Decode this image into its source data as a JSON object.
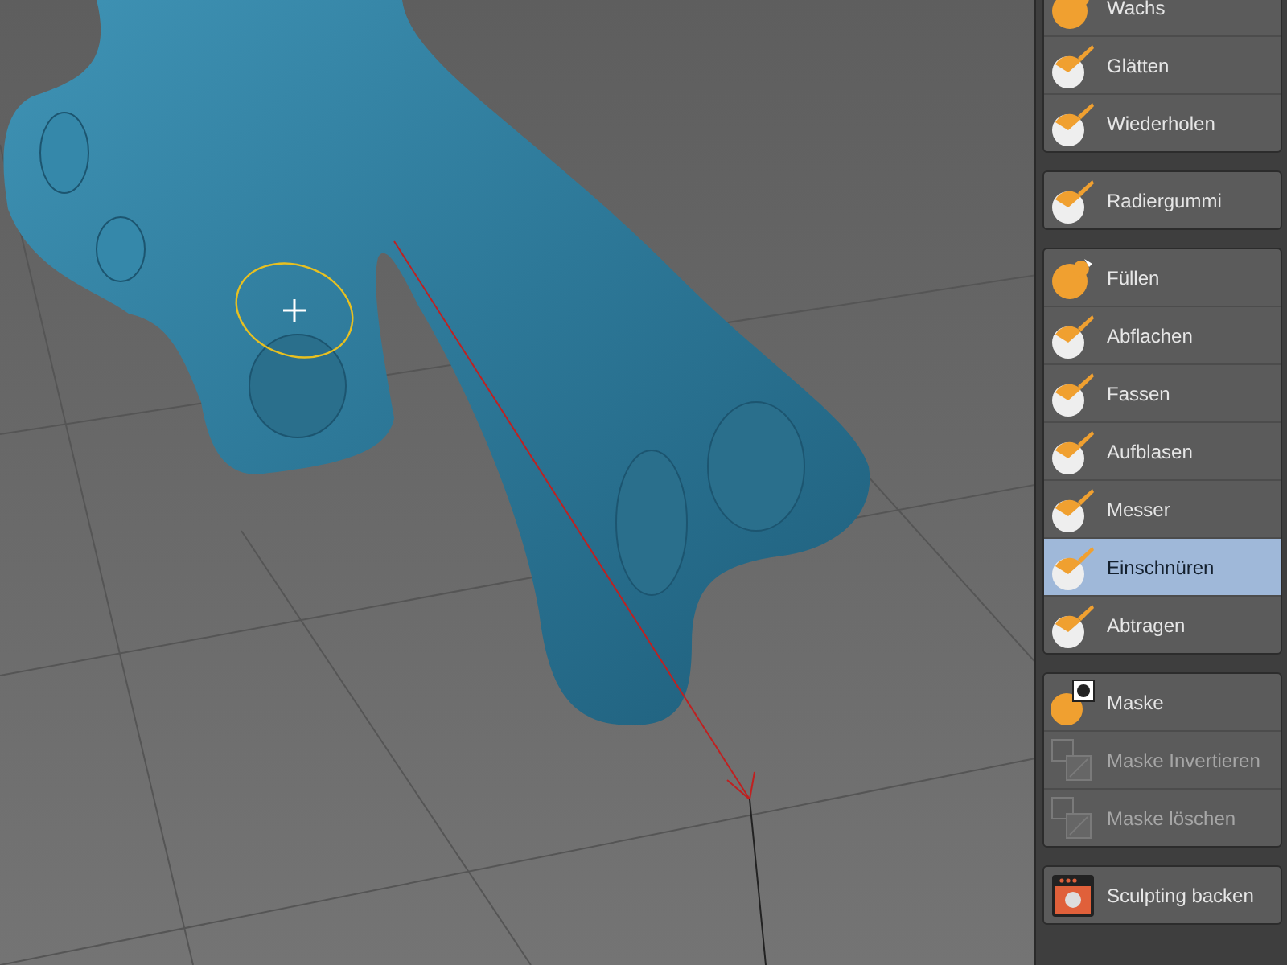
{
  "tool_groups": [
    {
      "tools": [
        {
          "label": "Wachs",
          "kind": "blob",
          "selected": false,
          "disabled": false
        },
        {
          "label": "Glätten",
          "kind": "brush",
          "selected": false,
          "disabled": false
        },
        {
          "label": "Wiederholen",
          "kind": "brush",
          "selected": false,
          "disabled": false
        }
      ]
    },
    {
      "tools": [
        {
          "label": "Radiergummi",
          "kind": "brush",
          "selected": false,
          "disabled": false
        }
      ]
    },
    {
      "tools": [
        {
          "label": "Füllen",
          "kind": "blob",
          "selected": false,
          "disabled": false
        },
        {
          "label": "Abflachen",
          "kind": "brush",
          "selected": false,
          "disabled": false
        },
        {
          "label": "Fassen",
          "kind": "brush",
          "selected": false,
          "disabled": false
        },
        {
          "label": "Aufblasen",
          "kind": "brush",
          "selected": false,
          "disabled": false
        },
        {
          "label": "Messer",
          "kind": "brush",
          "selected": false,
          "disabled": false
        },
        {
          "label": "Einschnüren",
          "kind": "brush",
          "selected": true,
          "disabled": false
        },
        {
          "label": "Abtragen",
          "kind": "brush",
          "selected": false,
          "disabled": false
        }
      ]
    },
    {
      "tools": [
        {
          "label": "Maske",
          "kind": "mask",
          "selected": false,
          "disabled": false
        },
        {
          "label": "Maske Invertieren",
          "kind": "mask-action",
          "selected": false,
          "disabled": true
        },
        {
          "label": "Maske löschen",
          "kind": "mask-action",
          "selected": false,
          "disabled": true
        }
      ]
    },
    {
      "tools": [
        {
          "label": "Sculpting backen",
          "kind": "bake",
          "selected": false,
          "disabled": false
        }
      ]
    }
  ]
}
